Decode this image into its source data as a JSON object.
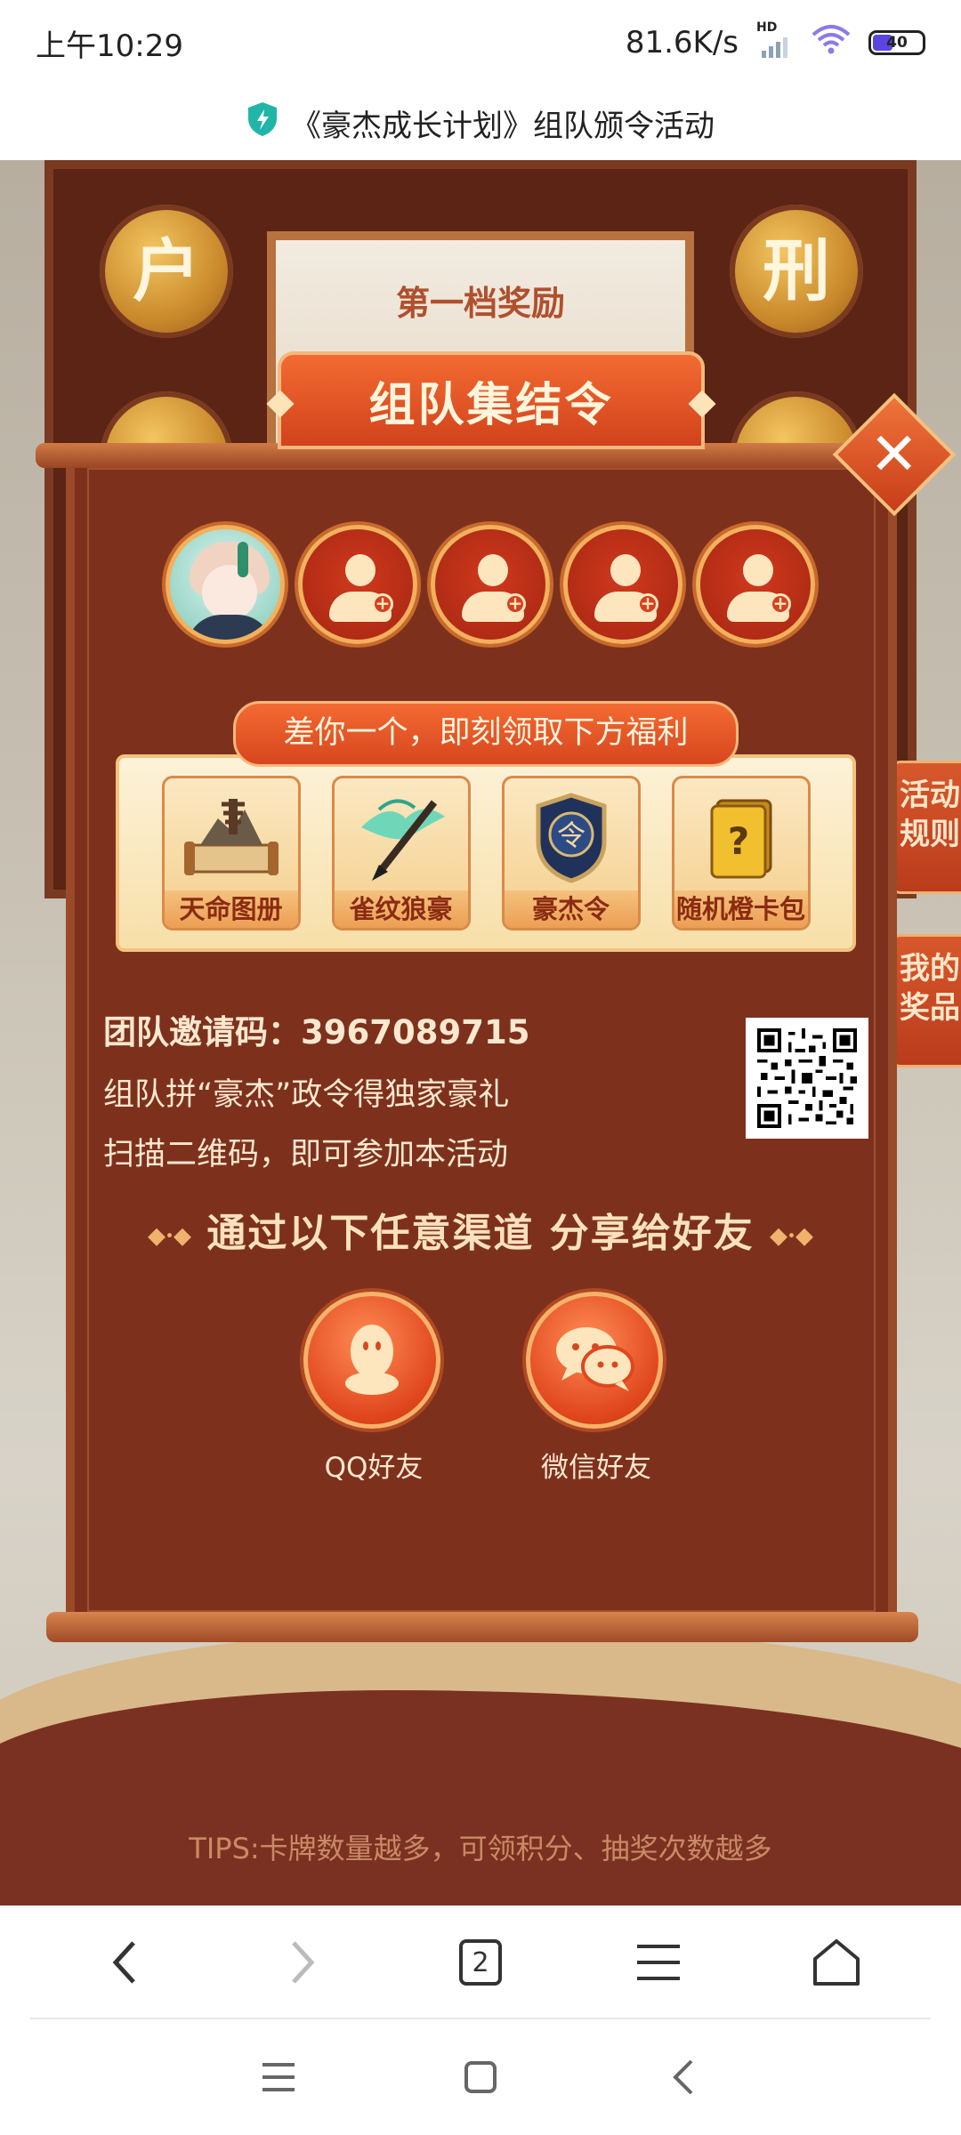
{
  "status_bar": {
    "time": "上午10:29",
    "network_speed": "81.6K/s",
    "network_badge": "HD",
    "battery_level": "40"
  },
  "title_bar": {
    "title": "《豪杰成长计划》组队颁令活动",
    "shield_icon": "shield-check-icon",
    "accent_color": "#21b5a8"
  },
  "background": {
    "coin_left_top": "户",
    "coin_right_top": "刑",
    "scroll_title": "第一档奖励",
    "side_tabs": [
      "活动规则",
      "我的奖品"
    ]
  },
  "modal": {
    "header": "组队集结令",
    "close_icon": "close-icon",
    "team_slots": [
      {
        "type": "member",
        "icon": "avatar"
      },
      {
        "type": "empty",
        "icon": "add-user-icon"
      },
      {
        "type": "empty",
        "icon": "add-user-icon"
      },
      {
        "type": "empty",
        "icon": "add-user-icon"
      },
      {
        "type": "empty",
        "icon": "add-user-icon"
      }
    ],
    "reward_banner": "差你一个，即刻领取下方福利",
    "rewards": [
      {
        "label": "天命图册",
        "icon": "scroll-map-icon"
      },
      {
        "label": "雀纹狼豪",
        "icon": "brush-icon"
      },
      {
        "label": "豪杰令",
        "icon": "badge-icon"
      },
      {
        "label": "随机橙卡包",
        "icon": "mystery-card-icon"
      }
    ],
    "invite_code_label": "团队邀请码：",
    "invite_code": "3967089715",
    "line1": "组队拼“豪杰”政令得独家豪礼",
    "line2": "扫描二维码，即可参加本活动",
    "qr_icon": "qr-code",
    "share_heading": "通过以下任意渠道 分享给好友",
    "share_buttons": [
      {
        "label": "QQ好友",
        "icon": "qq-icon"
      },
      {
        "label": "微信好友",
        "icon": "wechat-icon"
      }
    ]
  },
  "tips": "TIPS:卡牌数量越多，可领积分、抽奖次数越多",
  "browser_bar": {
    "tab_count": "2",
    "buttons": [
      "back-icon",
      "forward-icon",
      "tabs-icon",
      "menu-icon",
      "home-icon"
    ]
  },
  "system_nav": [
    "recents-icon",
    "home-square-icon",
    "back-triangle-icon"
  ]
}
